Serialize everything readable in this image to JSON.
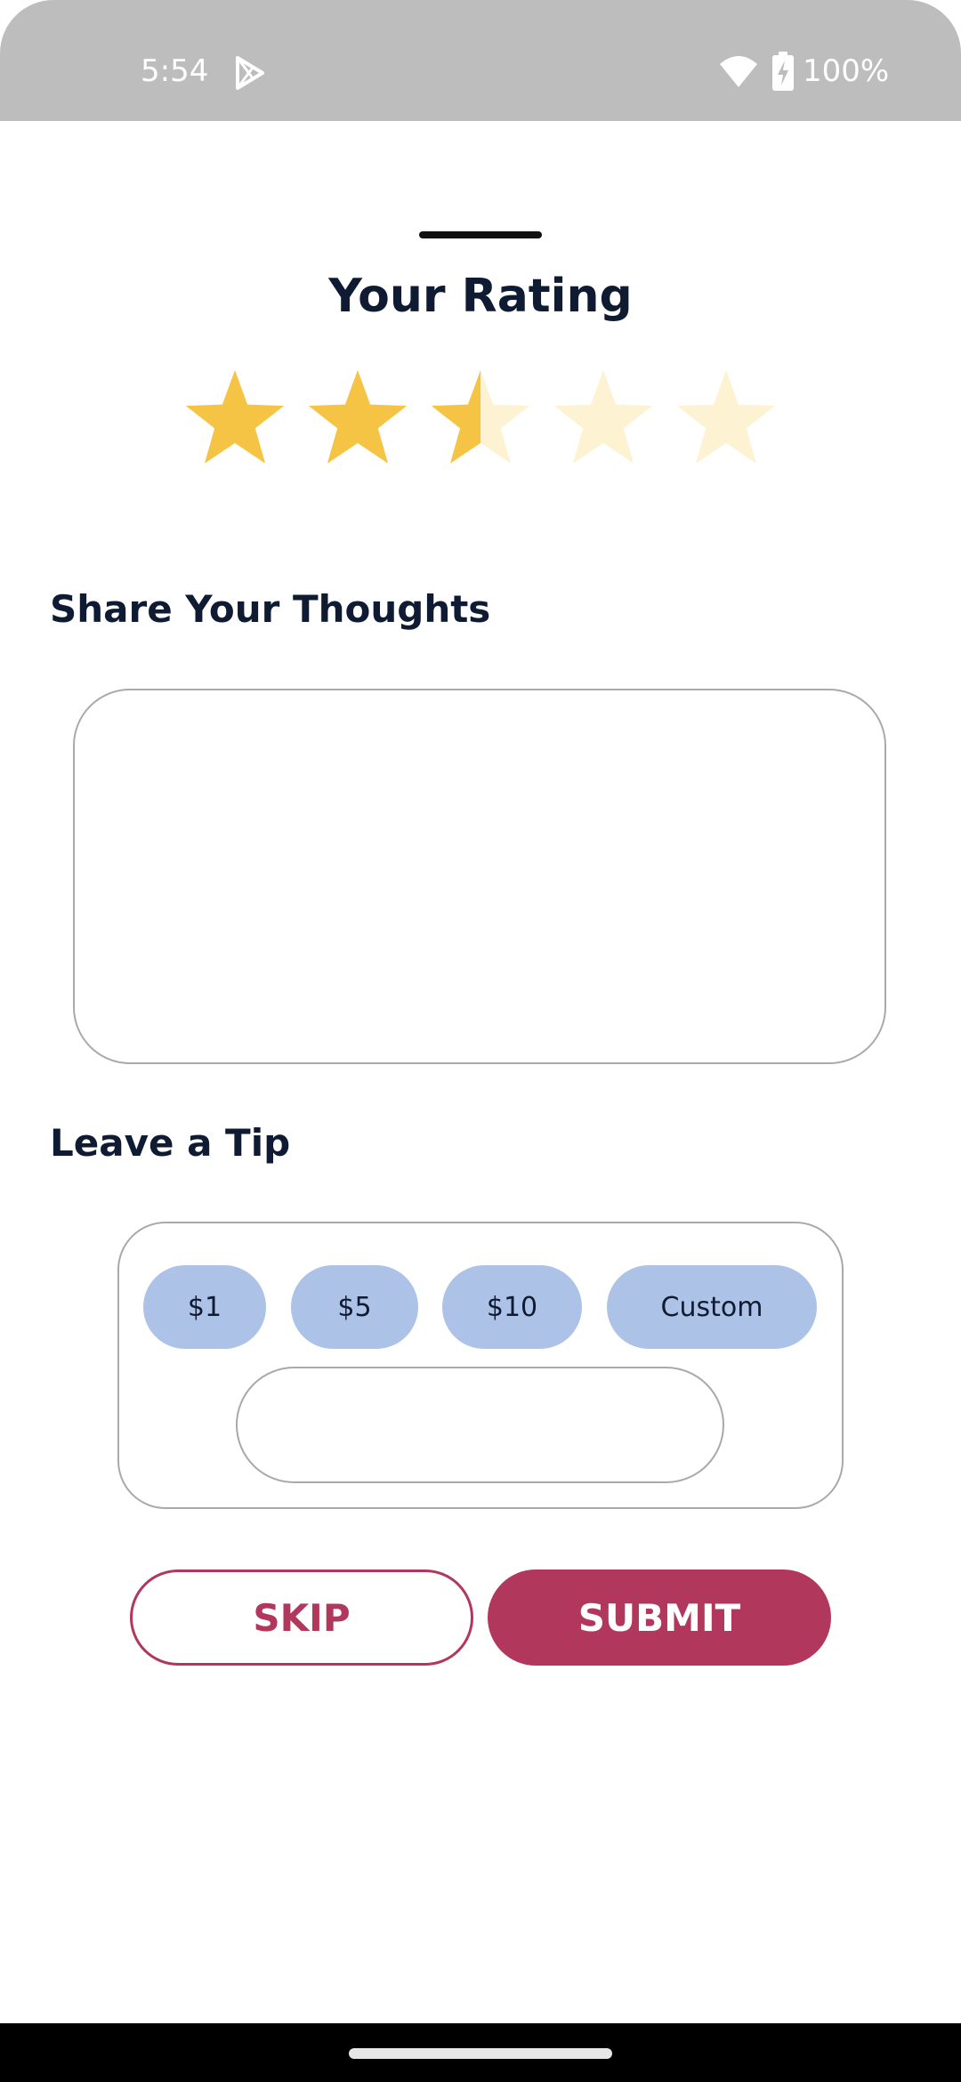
{
  "status_bar": {
    "time": "5:54",
    "battery": "100%",
    "icons": [
      "play-store-icon",
      "wifi-icon",
      "battery-charging-icon"
    ]
  },
  "sheet": {
    "title": "Your Rating",
    "rating": {
      "value": 2.5,
      "max": 5,
      "filled_color": "#f5c444",
      "empty_color": "#fdf2d2"
    },
    "thoughts": {
      "label": "Share Your Thoughts",
      "value": "",
      "placeholder": ""
    },
    "tip": {
      "label": "Leave a Tip",
      "options": [
        "$1",
        "$5",
        "$10",
        "Custom"
      ],
      "custom_value": ""
    },
    "actions": {
      "skip_label": "SKIP",
      "submit_label": "SUBMIT"
    }
  },
  "colors": {
    "primary": "#b2375c",
    "chip": "#adc2e7",
    "text": "#0f1b33",
    "border": "#a9a9a9"
  }
}
